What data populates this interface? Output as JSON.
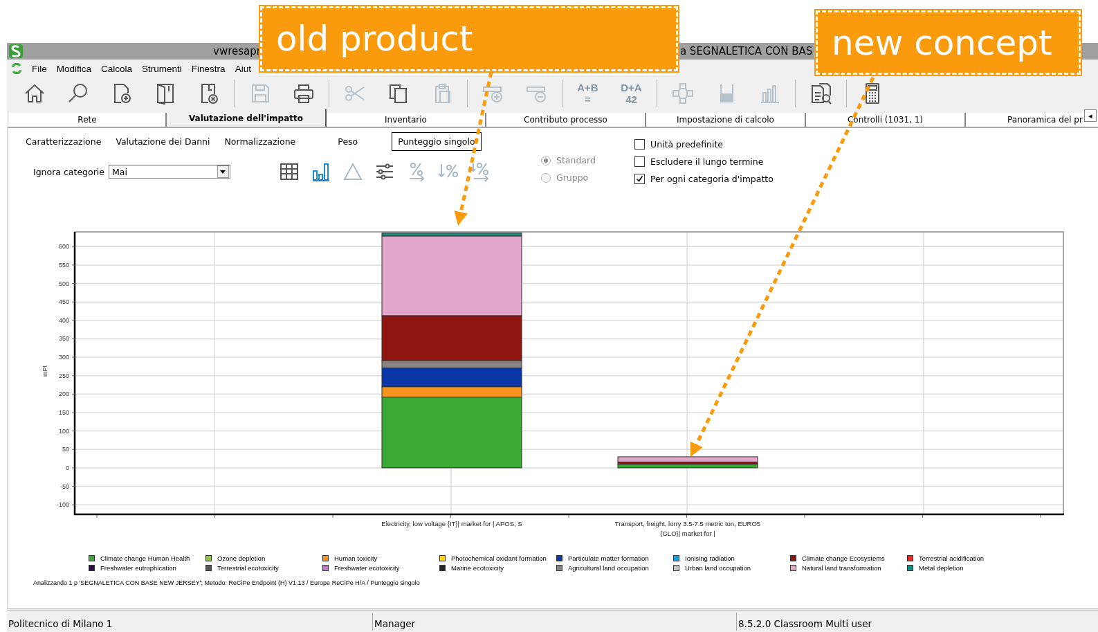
{
  "annotations": [
    {
      "text": "old product"
    },
    {
      "text": "new concept"
    }
  ],
  "window": {
    "title_fragments": [
      "vwresapr",
      "a SEGNALETICA CON BAS"
    ]
  },
  "menu": [
    "File",
    "Modifica",
    "Calcola",
    "Strumenti",
    "Finestra",
    "Aiut"
  ],
  "toolbar": {
    "groups": [
      [
        {
          "kind": "home",
          "disabled": false
        },
        {
          "kind": "search",
          "disabled": false
        },
        {
          "kind": "new",
          "disabled": false
        },
        {
          "kind": "open",
          "disabled": false
        },
        {
          "kind": "delete",
          "disabled": false
        }
      ],
      [
        {
          "kind": "save",
          "disabled": true
        },
        {
          "kind": "print",
          "disabled": false
        }
      ],
      [
        {
          "kind": "cut",
          "disabled": true
        },
        {
          "kind": "copy",
          "disabled": false
        },
        {
          "kind": "paste",
          "disabled": true
        }
      ],
      [
        {
          "kind": "add",
          "disabled": true
        },
        {
          "kind": "remove",
          "disabled": true
        }
      ],
      [
        {
          "kind": "text",
          "label": "A+B",
          "sub": "=",
          "disabled": true
        },
        {
          "kind": "text",
          "label": "D+A",
          "sub": "42",
          "disabled": true
        }
      ],
      [
        {
          "kind": "network",
          "disabled": true
        },
        {
          "kind": "gauge",
          "disabled": true
        },
        {
          "kind": "bars",
          "disabled": true
        }
      ],
      [
        {
          "kind": "report",
          "disabled": false
        }
      ],
      [
        {
          "kind": "calculator",
          "disabled": false
        }
      ]
    ]
  },
  "tabs": [
    {
      "label": "Rete",
      "selected": false
    },
    {
      "label": "Valutazione dell'impatto",
      "selected": true
    },
    {
      "label": "Inventario",
      "selected": false
    },
    {
      "label": "Contributo processo",
      "selected": false
    },
    {
      "label": "Impostazione di calcolo",
      "selected": false
    },
    {
      "label": "Controlli (1031, 1)",
      "selected": false
    },
    {
      "label": "Panoramica del pr",
      "selected": false
    }
  ],
  "tab_scroll": "◂",
  "subtabs": [
    {
      "label": "Caratterizzazione",
      "selected": false
    },
    {
      "label": "Valutazione dei Danni",
      "selected": false
    },
    {
      "label": "Normalizzazione",
      "selected": false
    },
    {
      "label": "Peso",
      "selected": false
    },
    {
      "label": "Punteggio singolo",
      "selected": true
    }
  ],
  "ignore_categories": {
    "label": "Ignora categorie",
    "value": "Mai"
  },
  "view_buttons": [
    {
      "kind": "table",
      "selected": false,
      "disabled": false
    },
    {
      "kind": "bars",
      "selected": true,
      "disabled": false
    },
    {
      "kind": "triangle",
      "selected": false,
      "disabled": true
    },
    {
      "kind": "sliders",
      "selected": false,
      "disabled": false
    },
    {
      "kind": "percent",
      "selected": false,
      "disabled": true
    },
    {
      "kind": "sortpercent",
      "selected": false,
      "disabled": true
    },
    {
      "kind": "percentarrow",
      "selected": false,
      "disabled": true
    }
  ],
  "radios": [
    {
      "label": "Standard",
      "selected": true,
      "disabled": true
    },
    {
      "label": "Gruppo",
      "selected": false,
      "disabled": true
    }
  ],
  "checkboxes": [
    {
      "label": "Unità predefinite",
      "checked": false
    },
    {
      "label": "Escludere il lungo termine",
      "checked": false
    },
    {
      "label": "Per ogni categoria d'impatto",
      "checked": true
    }
  ],
  "chart": {
    "chart_data": {
      "type": "bar",
      "stacked": true,
      "grid": true,
      "ylabel": "mPt",
      "categories": [
        "Electricity, low voltage {IT}| market for | APOS, S",
        "Transport, freight, lorry 3.5-7.5 metric ton, EURO5 {GLO}| market for |"
      ],
      "ylim": [
        -126,
        640
      ],
      "yticks": [
        -100,
        -50,
        0,
        50,
        100,
        150,
        200,
        250,
        300,
        350,
        400,
        450,
        500,
        550,
        600
      ],
      "series": [
        {
          "name": "Climate change Human Health",
          "color": "#3aaa35",
          "values": [
            192,
            10
          ]
        },
        {
          "name": "Freshwater eutrophication",
          "color": "#2d0a50",
          "values": [
            0,
            0
          ]
        },
        {
          "name": "Ozone depletion",
          "color": "#8dc63f",
          "values": [
            0,
            0
          ]
        },
        {
          "name": "Terrestrial ecotoxicity",
          "color": "#595959",
          "values": [
            0,
            0
          ]
        },
        {
          "name": "Human toxicity",
          "color": "#f7941d",
          "values": [
            28,
            0
          ]
        },
        {
          "name": "Freshwater ecotoxicity",
          "color": "#c879c8",
          "values": [
            0,
            0
          ]
        },
        {
          "name": "Photochemical oxidant formation",
          "color": "#ffd200",
          "values": [
            0,
            0
          ]
        },
        {
          "name": "Marine ecotoxicity",
          "color": "#262626",
          "values": [
            0,
            0
          ]
        },
        {
          "name": "Particulate matter formation",
          "color": "#0b36a8",
          "values": [
            51,
            0
          ]
        },
        {
          "name": "Agricultural land occupation",
          "color": "#8c8484",
          "values": [
            20,
            0
          ]
        },
        {
          "name": "Ionising radiation",
          "color": "#1ba1e2",
          "values": [
            0,
            0
          ]
        },
        {
          "name": "Urban land occupation",
          "color": "#c4c4c4",
          "values": [
            0,
            0
          ]
        },
        {
          "name": "Climate change Ecosystems",
          "color": "#8e1510",
          "values": [
            122,
            6
          ]
        },
        {
          "name": "Natural land transformation",
          "color": "#e2a6cc",
          "values": [
            216,
            14
          ]
        },
        {
          "name": "Terrestrial acidification",
          "color": "#e8281e",
          "values": [
            0,
            0
          ]
        },
        {
          "name": "Metal depletion",
          "color": "#138c84",
          "values": [
            8,
            0
          ]
        }
      ]
    },
    "footnote": "Analizzando 1 p 'SEGNALETICA CON BASE NEW JERSEY';  Metodo: ReCiPe Endpoint (H) V1.13 / Europe ReCiPe H/A / Punteggio singolo"
  },
  "status_bar": [
    "Politecnico di Milano 1",
    "Manager",
    "8.5.2.0 Classroom Multi user"
  ]
}
